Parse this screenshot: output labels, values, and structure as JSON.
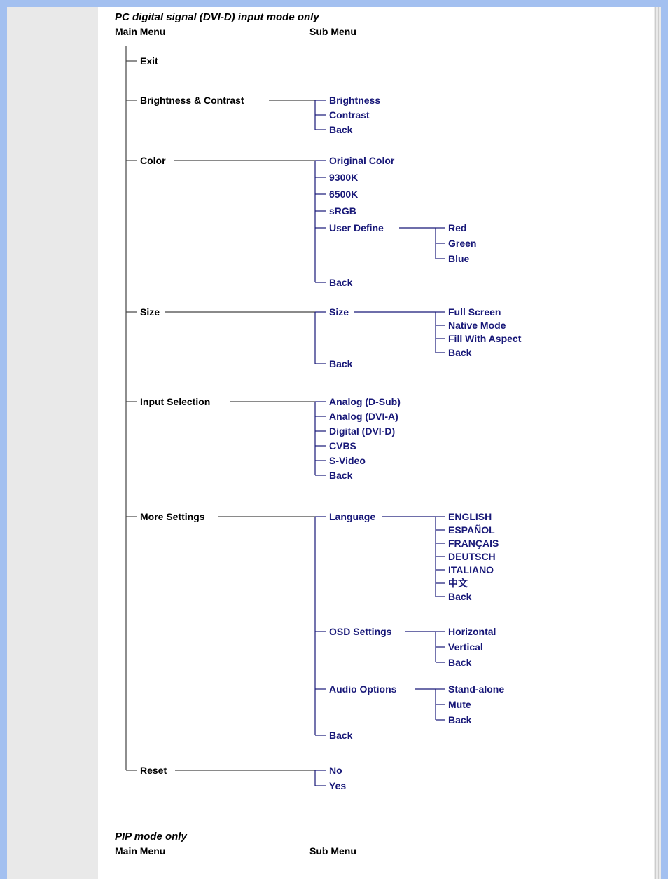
{
  "section1": {
    "title": "PC digital signal (DVI-D) input mode only",
    "mainMenuHeader": "Main Menu",
    "subMenuHeader": "Sub Menu",
    "items": {
      "exit": "Exit",
      "brightness": {
        "label": "Brightness & Contrast",
        "sub": {
          "brightness": "Brightness",
          "contrast": "Contrast",
          "back": "Back"
        }
      },
      "color": {
        "label": "Color",
        "sub": {
          "original": "Original Color",
          "k9300": "9300K",
          "k6500": "6500K",
          "srgb": "sRGB",
          "userDefine": {
            "label": "User Define",
            "sub": {
              "red": "Red",
              "green": "Green",
              "blue": "Blue"
            }
          },
          "back": "Back"
        }
      },
      "size": {
        "label": "Size",
        "sub": {
          "size": {
            "label": "Size",
            "sub": {
              "full": "Full Screen",
              "native": "Native Mode",
              "fill": "Fill With Aspect",
              "back": "Back"
            }
          },
          "back": "Back"
        }
      },
      "input": {
        "label": "Input Selection",
        "sub": {
          "dsub": "Analog (D-Sub)",
          "dvia": "Analog (DVI-A)",
          "dvid": "Digital (DVI-D)",
          "cvbs": "CVBS",
          "svideo": "S-Video",
          "back": "Back"
        }
      },
      "more": {
        "label": "More Settings",
        "sub": {
          "language": {
            "label": "Language",
            "sub": {
              "en": "ENGLISH",
              "es": "ESPAÑOL",
              "fr": "FRANÇAIS",
              "de": "DEUTSCH",
              "it": "ITALIANO",
              "zh": "中文",
              "back": "Back"
            }
          },
          "osd": {
            "label": "OSD Settings",
            "sub": {
              "h": "Horizontal",
              "v": "Vertical",
              "back": "Back"
            }
          },
          "audio": {
            "label": "Audio Options",
            "sub": {
              "standalone": "Stand-alone",
              "mute": "Mute",
              "back": "Back"
            }
          },
          "back": "Back"
        }
      },
      "reset": {
        "label": "Reset",
        "sub": {
          "no": "No",
          "yes": "Yes"
        }
      }
    }
  },
  "section2": {
    "title": "PIP mode only",
    "mainMenuHeader": "Main Menu",
    "subMenuHeader": "Sub Menu"
  }
}
